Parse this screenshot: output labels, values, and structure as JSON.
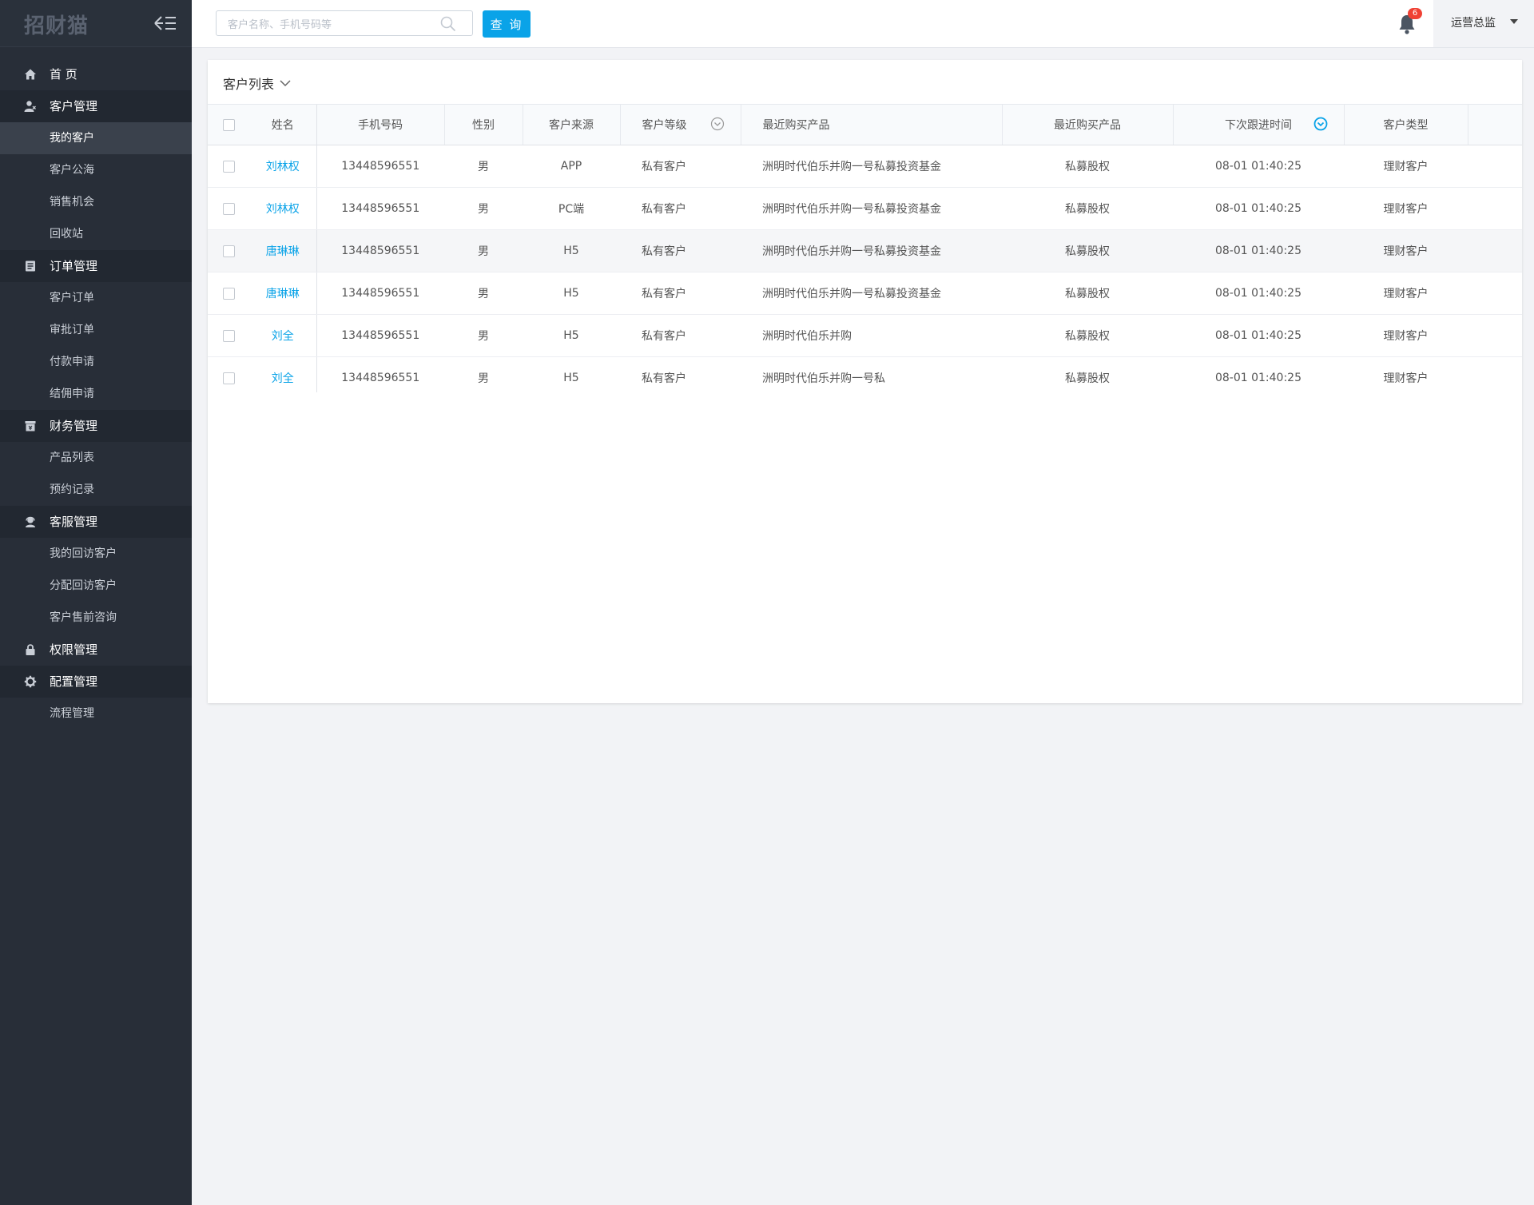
{
  "app": {
    "logo": "招财猫"
  },
  "sidebar": {
    "groups": [
      {
        "label": "首 页",
        "icon": "home-icon",
        "items": []
      },
      {
        "label": "客户管理",
        "icon": "customer-icon",
        "items": [
          "我的客户",
          "客户公海",
          "销售机会",
          "回收站"
        ]
      },
      {
        "label": "订单管理",
        "icon": "order-icon",
        "items": [
          "客户订单",
          "审批订单",
          "付款申请",
          "结佣申请"
        ]
      },
      {
        "label": "财务管理",
        "icon": "finance-icon",
        "items": [
          "产品列表",
          "预约记录"
        ]
      },
      {
        "label": "客服管理",
        "icon": "service-icon",
        "items": [
          "我的回访客户",
          "分配回访客户",
          "客户售前咨询"
        ]
      },
      {
        "label": "权限管理",
        "icon": "lock-icon",
        "items": []
      },
      {
        "label": "配置管理",
        "icon": "gear-icon",
        "items": [
          "流程管理"
        ]
      }
    ],
    "active_item": "我的客户"
  },
  "topbar": {
    "search_placeholder": "客户名称、手机号码等",
    "query_label": "查 询",
    "notification_count": "6",
    "user_name": "运营总监"
  },
  "panel": {
    "title": "客户列表"
  },
  "table": {
    "columns": [
      "姓名",
      "手机号码",
      "性别",
      "客户来源",
      "客户等级",
      "最近购买产品",
      "最近购买产品",
      "下次跟进时间",
      "客户类型"
    ],
    "rows": [
      {
        "name": "刘林权",
        "phone": "13448596551",
        "gender": "男",
        "source": "APP",
        "level": "私有客户",
        "product": "洲明时代伯乐并购一号私募投资基金",
        "product_type": "私募股权",
        "next_time": "08-01 01:40:25",
        "type": "理财客户"
      },
      {
        "name": "刘林权",
        "phone": "13448596551",
        "gender": "男",
        "source": "PC端",
        "level": "私有客户",
        "product": "洲明时代伯乐并购一号私募投资基金",
        "product_type": "私募股权",
        "next_time": "08-01 01:40:25",
        "type": "理财客户"
      },
      {
        "name": "唐琳琳",
        "phone": "13448596551",
        "gender": "男",
        "source": "H5",
        "level": "私有客户",
        "product": "洲明时代伯乐并购一号私募投资基金",
        "product_type": "私募股权",
        "next_time": "08-01 01:40:25",
        "type": "理财客户"
      },
      {
        "name": "唐琳琳",
        "phone": "13448596551",
        "gender": "男",
        "source": "H5",
        "level": "私有客户",
        "product": "洲明时代伯乐并购一号私募投资基金",
        "product_type": "私募股权",
        "next_time": "08-01 01:40:25",
        "type": "理财客户"
      },
      {
        "name": "刘全",
        "phone": "13448596551",
        "gender": "男",
        "source": "H5",
        "level": "私有客户",
        "product": "洲明时代伯乐并购",
        "product_type": "私募股权",
        "next_time": "08-01 01:40:25",
        "type": "理财客户"
      },
      {
        "name": "刘全",
        "phone": "13448596551",
        "gender": "男",
        "source": "H5",
        "level": "私有客户",
        "product": "洲明时代伯乐并购一号私",
        "product_type": "私募股权",
        "next_time": "08-01 01:40:25",
        "type": "理财客户"
      }
    ],
    "highlighted_row": 2
  },
  "colors": {
    "sidebar_bg": "#282e38",
    "accent": "#0aa3e8",
    "badge": "#f04134",
    "page_bg": "#f2f3f6"
  }
}
